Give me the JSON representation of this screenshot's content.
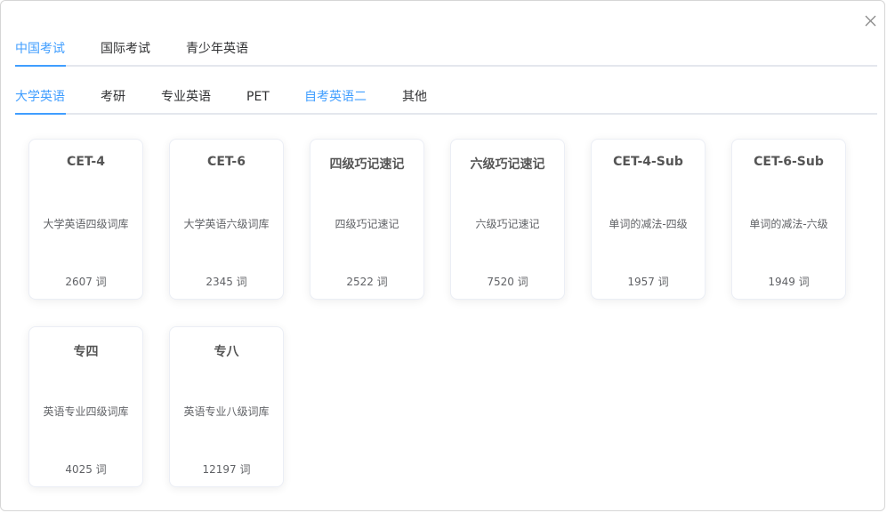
{
  "dialog": {
    "close_icon": "close-icon"
  },
  "primary_tabs": [
    {
      "label": "中国考试",
      "active": true
    },
    {
      "label": "国际考试",
      "active": false
    },
    {
      "label": "青少年英语",
      "active": false
    }
  ],
  "secondary_tabs": [
    {
      "label": "大学英语",
      "active": true
    },
    {
      "label": "考研",
      "active": false
    },
    {
      "label": "专业英语",
      "active": false
    },
    {
      "label": "PET",
      "active": false
    },
    {
      "label": "自考英语二",
      "active": false,
      "highlighted": true
    },
    {
      "label": "其他",
      "active": false
    }
  ],
  "cards": [
    {
      "title": "CET-4",
      "desc": "大学英语四级词库",
      "count": "2607 词"
    },
    {
      "title": "CET-6",
      "desc": "大学英语六级词库",
      "count": "2345 词"
    },
    {
      "title": "四级巧记速记",
      "desc": "四级巧记速记",
      "count": "2522 词"
    },
    {
      "title": "六级巧记速记",
      "desc": "六级巧记速记",
      "count": "7520 词"
    },
    {
      "title": "CET-4-Sub",
      "desc": "单词的减法-四级",
      "count": "1957 词"
    },
    {
      "title": "CET-6-Sub",
      "desc": "单词的减法-六级",
      "count": "1949 词"
    },
    {
      "title": "专四",
      "desc": "英语专业四级词库",
      "count": "4025 词"
    },
    {
      "title": "专八",
      "desc": "英语专业八级词库",
      "count": "12197 词"
    }
  ],
  "colors": {
    "accent": "#409eff",
    "text": "#303133",
    "card_title": "#555555",
    "card_text": "#606266",
    "divider": "#e4e7ed"
  }
}
